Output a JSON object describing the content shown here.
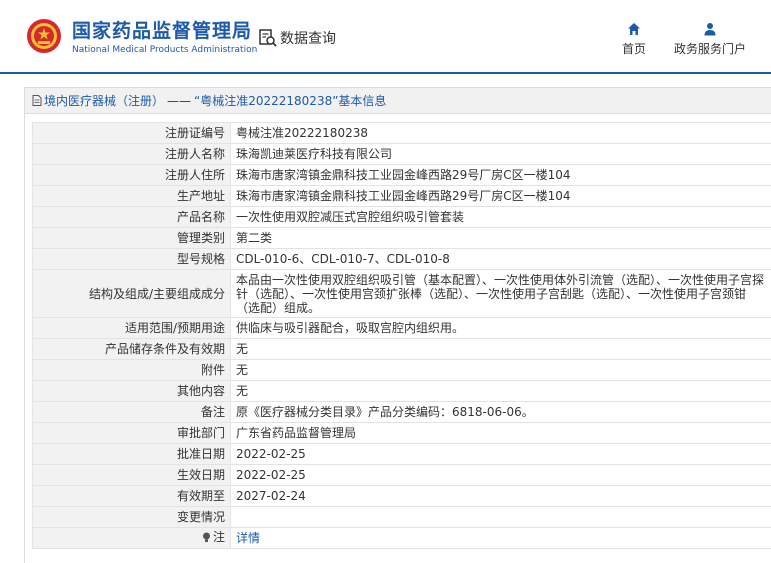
{
  "header": {
    "brand_cn": "国家药品监督管理局",
    "brand_en": "National Medical Products Administration",
    "search_label": "数据查询",
    "nav": {
      "home": "首页",
      "portal": "政务服务门户"
    },
    "accent_color": "#1e5aa8",
    "logo_color": "#d7282f"
  },
  "breadcrumb": {
    "category": "境内医疗器械（注册）",
    "separator": "——",
    "current": "“粤械注准20222180238”基本信息"
  },
  "details": [
    {
      "label": "注册证编号",
      "value": "粤械注准20222180238"
    },
    {
      "label": "注册人名称",
      "value": "珠海凯迪莱医疗科技有限公司"
    },
    {
      "label": "注册人住所",
      "value": "珠海市唐家湾镇金鼎科技工业园金峰西路29号厂房C区一楼104"
    },
    {
      "label": "生产地址",
      "value": "珠海市唐家湾镇金鼎科技工业园金峰西路29号厂房C区一楼104"
    },
    {
      "label": "产品名称",
      "value": "一次性使用双腔减压式宫腔组织吸引管套装"
    },
    {
      "label": "管理类别",
      "value": "第二类"
    },
    {
      "label": "型号规格",
      "value": "CDL-010-6、CDL-010-7、CDL-010-8"
    },
    {
      "label": "结构及组成/主要组成成分",
      "value": "本品由一次性使用双腔组织吸引管（基本配置）、一次性使用体外引流管（选配）、一次性使用子宫探针（选配）、一次性使用宫颈扩张棒（选配）、一次性使用子宫刮匙（选配）、一次性使用子宫颈钳（选配）组成。"
    },
    {
      "label": "适用范围/预期用途",
      "value": "供临床与吸引器配合，吸取宫腔内组织用。"
    },
    {
      "label": "产品储存条件及有效期",
      "value": "无"
    },
    {
      "label": "附件",
      "value": "无"
    },
    {
      "label": "其他内容",
      "value": "无"
    },
    {
      "label": "备注",
      "value": "原《医疗器械分类目录》产品分类编码：6818-06-06。"
    },
    {
      "label": "审批部门",
      "value": "广东省药品监督管理局"
    },
    {
      "label": "批准日期",
      "value": "2022-02-25"
    },
    {
      "label": "生效日期",
      "value": "2022-02-25"
    },
    {
      "label": "有效期至",
      "value": "2027-02-24"
    },
    {
      "label": "变更情况",
      "value": ""
    }
  ],
  "note": {
    "label": "注",
    "link": "详情",
    "icon": "bulb-icon"
  }
}
